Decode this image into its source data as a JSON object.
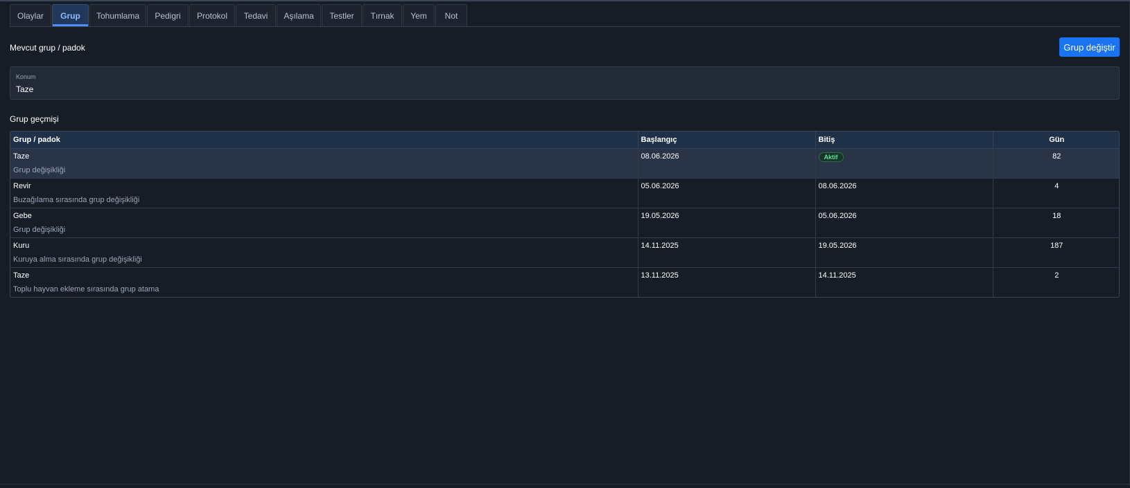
{
  "tabs": [
    {
      "label": "Olaylar",
      "active": false
    },
    {
      "label": "Grup",
      "active": true
    },
    {
      "label": "Tohumlama",
      "active": false
    },
    {
      "label": "Pedigri",
      "active": false
    },
    {
      "label": "Protokol",
      "active": false
    },
    {
      "label": "Tedavi",
      "active": false
    },
    {
      "label": "Aşılama",
      "active": false
    },
    {
      "label": "Testler",
      "active": false
    },
    {
      "label": "Tırnak",
      "active": false
    },
    {
      "label": "Yem",
      "active": false
    },
    {
      "label": "Not",
      "active": false
    }
  ],
  "current": {
    "title": "Mevcut grup / padok",
    "change_button": "Grup değiştir",
    "location_label": "Konum",
    "location_value": "Taze"
  },
  "history": {
    "title": "Grup geçmişi",
    "columns": {
      "group": "Grup / padok",
      "start": "Başlangıç",
      "end": "Bitiş",
      "days": "Gün"
    },
    "rows": [
      {
        "group": "Taze",
        "reason": "Grup değişikliği",
        "start": "08.06.2026",
        "end": "",
        "badge": "Aktif",
        "days": "82",
        "active": true
      },
      {
        "group": "Revir",
        "reason": "Buzağılama sırasında grup değişikliği",
        "start": "05.06.2026",
        "end": "08.06.2026",
        "badge": "",
        "days": "4",
        "active": false
      },
      {
        "group": "Gebe",
        "reason": "Grup değişikliği",
        "start": "19.05.2026",
        "end": "05.06.2026",
        "badge": "",
        "days": "18",
        "active": false
      },
      {
        "group": "Kuru",
        "reason": "Kuruya alma sırasında grup değişikliği",
        "start": "14.11.2025",
        "end": "19.05.2026",
        "badge": "",
        "days": "187",
        "active": false
      },
      {
        "group": "Taze",
        "reason": "Toplu hayvan ekleme sırasında grup atama",
        "start": "13.11.2025",
        "end": "14.11.2025",
        "badge": "",
        "days": "2",
        "active": false
      }
    ]
  },
  "colors": {
    "background": "#171d26",
    "accent": "#1a73f0",
    "active_tab": "#8fbaff",
    "badge_green": "#5fe09a"
  }
}
